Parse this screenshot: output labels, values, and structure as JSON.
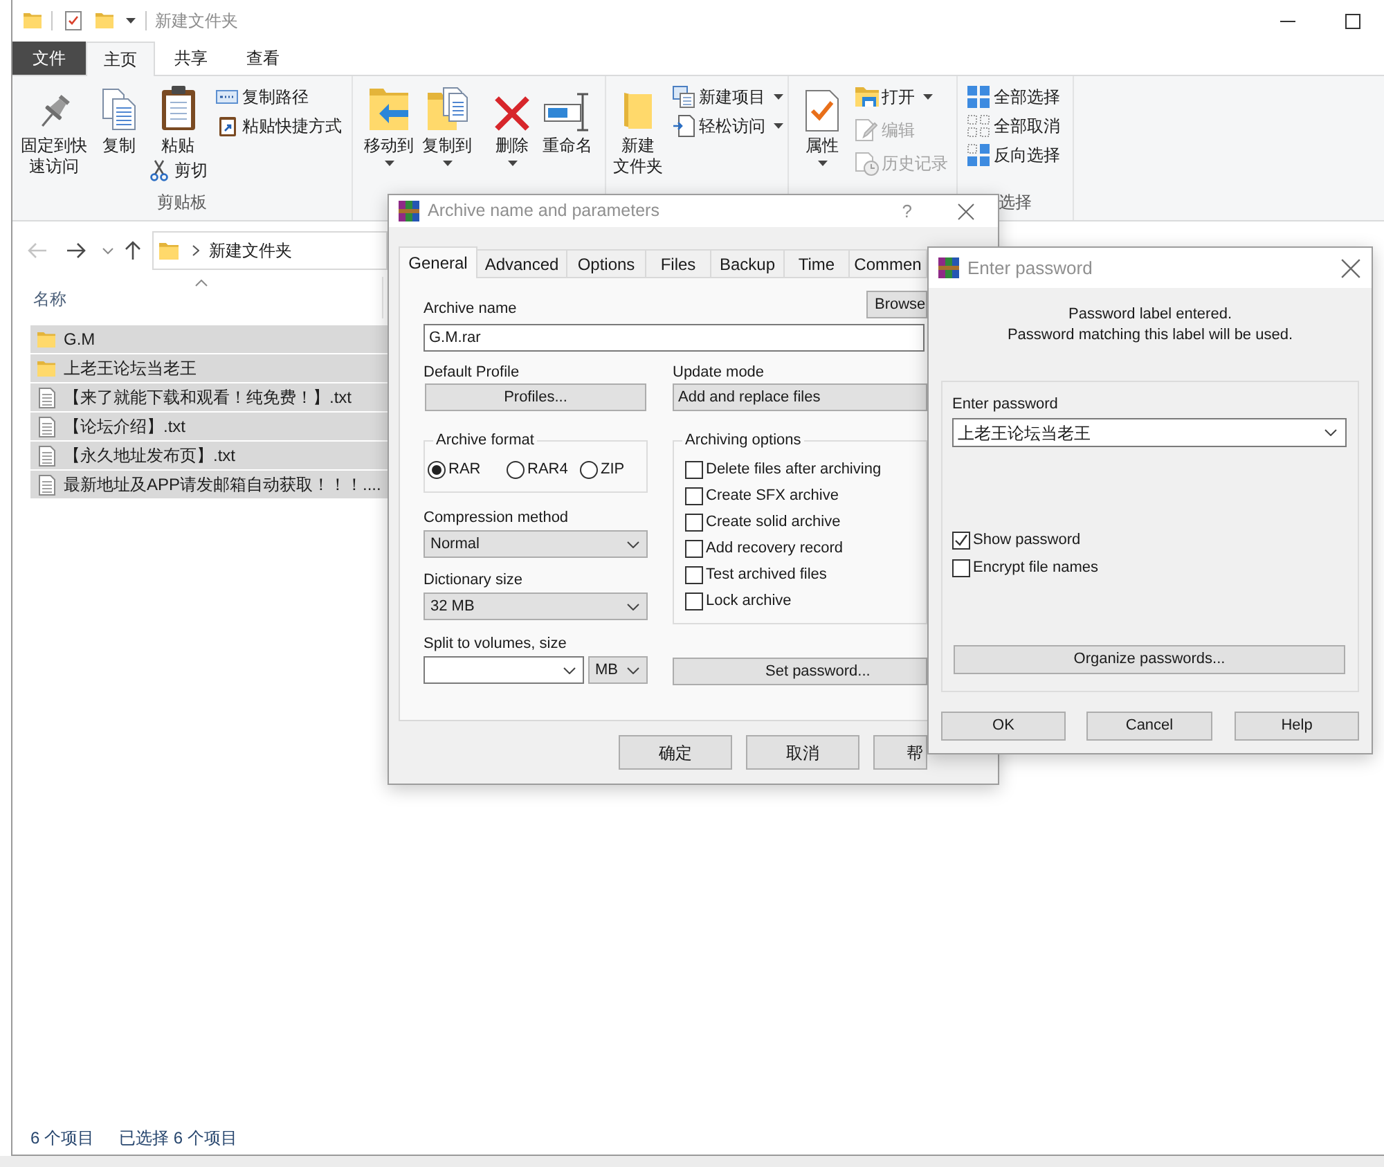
{
  "explorer": {
    "title_bar": {
      "title": "新建文件夹"
    },
    "ribbon_tabs": [
      {
        "label": "文件",
        "kind": "file",
        "selected": false
      },
      {
        "label": "主页",
        "kind": "tab",
        "selected": true
      },
      {
        "label": "共享",
        "kind": "tab",
        "selected": false
      },
      {
        "label": "查看",
        "kind": "tab",
        "selected": false
      }
    ],
    "ribbon": {
      "groups": [
        {
          "label": "剪贴板",
          "buttons": [
            {
              "lines": [
                "固定到快",
                "速访问"
              ],
              "dropdown": false,
              "disabled": false
            },
            {
              "label": "复制",
              "dropdown": false,
              "disabled": false
            },
            {
              "label": "粘贴",
              "dropdown": false,
              "disabled": false
            },
            {
              "label": "剪切",
              "dropdown": false,
              "disabled": false
            },
            {
              "label": "复制路径",
              "dropdown": false,
              "disabled": false
            },
            {
              "label": "粘贴快捷方式",
              "dropdown": false,
              "disabled": false
            }
          ]
        },
        {
          "buttons": [
            {
              "label": "移动到",
              "dropdown": true,
              "disabled": false
            },
            {
              "label": "复制到",
              "dropdown": true,
              "disabled": false
            },
            {
              "label": "删除",
              "dropdown": true,
              "disabled": false
            },
            {
              "label": "重命名",
              "dropdown": false,
              "disabled": false
            }
          ]
        },
        {
          "buttons": [
            {
              "lines": [
                "新建",
                "文件夹"
              ],
              "dropdown": false,
              "disabled": false
            },
            {
              "label": "新建项目",
              "dropdown": true,
              "disabled": false
            },
            {
              "label": "轻松访问",
              "dropdown": true,
              "disabled": false
            }
          ]
        },
        {
          "buttons": [
            {
              "label": "属性",
              "dropdown": true,
              "disabled": false
            },
            {
              "label": "打开",
              "dropdown": true,
              "disabled": false
            },
            {
              "label": "编辑",
              "dropdown": false,
              "disabled": true
            },
            {
              "label": "历史记录",
              "dropdown": false,
              "disabled": true
            }
          ]
        },
        {
          "label": "选择",
          "buttons": [
            {
              "label": "全部选择",
              "dropdown": false,
              "disabled": false
            },
            {
              "label": "全部取消",
              "dropdown": false,
              "disabled": false
            },
            {
              "label": "反向选择",
              "dropdown": false,
              "disabled": false
            }
          ]
        }
      ]
    },
    "navigation": [
      {
        "kind": "back",
        "disabled": true
      },
      {
        "kind": "forward",
        "disabled": false
      },
      {
        "kind": "recent",
        "disabled": false
      },
      {
        "kind": "up",
        "disabled": false
      }
    ],
    "address": {
      "path": "新建文件夹"
    },
    "columns": [
      {
        "label": "名称",
        "sorted": true
      }
    ],
    "files": [
      {
        "name": "G.M",
        "kind": "folder",
        "selected": true
      },
      {
        "name": "上老王论坛当老王",
        "kind": "folder",
        "selected": true
      },
      {
        "name": "【来了就能下载和观看！纯免费！】.txt",
        "kind": "text_file",
        "selected": true
      },
      {
        "name": "【论坛介绍】.txt",
        "kind": "text_file",
        "selected": true
      },
      {
        "name": "【永久地址发布页】.txt",
        "kind": "text_file",
        "selected": true
      },
      {
        "name": "最新地址及APP请发邮箱自动获取！！！....",
        "kind": "text_file",
        "selected": true
      }
    ],
    "status_bar": {
      "item_count": "6 个项目",
      "selection": "已选择 6 个项目"
    }
  },
  "archive_dialog": {
    "title": "Archive name and parameters",
    "help": "?",
    "tabs": [
      {
        "label": "General",
        "selected": true
      },
      {
        "label": "Advanced",
        "selected": false
      },
      {
        "label": "Options",
        "selected": false
      },
      {
        "label": "Files",
        "selected": false
      },
      {
        "label": "Backup",
        "selected": false
      },
      {
        "label": "Time",
        "selected": false
      },
      {
        "label": "Commen",
        "selected": false
      }
    ],
    "archive_name": {
      "label": "Archive name",
      "value": "G.M.rar",
      "browse_button": "Browse"
    },
    "default_profile": {
      "label": "Default Profile",
      "button": "Profiles..."
    },
    "update_mode": {
      "label": "Update mode",
      "value": "Add and replace files"
    },
    "archive_format": {
      "label": "Archive format",
      "options": [
        {
          "label": "RAR",
          "selected": true
        },
        {
          "label": "RAR4",
          "selected": false
        },
        {
          "label": "ZIP",
          "selected": false
        }
      ]
    },
    "archiving_options": {
      "label": "Archiving options",
      "options": [
        {
          "label": "Delete files after archiving",
          "checked": false
        },
        {
          "label": "Create SFX archive",
          "checked": false
        },
        {
          "label": "Create solid archive",
          "checked": false
        },
        {
          "label": "Add recovery record",
          "checked": false
        },
        {
          "label": "Test archived files",
          "checked": false
        },
        {
          "label": "Lock archive",
          "checked": false
        }
      ]
    },
    "compression_method": {
      "label": "Compression method",
      "value": "Normal"
    },
    "dictionary_size": {
      "label": "Dictionary size",
      "value": "32 MB"
    },
    "split_volumes": {
      "label": "Split to volumes, size",
      "unit": "MB"
    },
    "set_password_button": "Set password...",
    "buttons": [
      "确定",
      "取消",
      "帮"
    ]
  },
  "password_dialog": {
    "title": "Enter password",
    "message": [
      "Password label entered.",
      "Password matching this label will be used."
    ],
    "password": {
      "label": "Enter password",
      "value": "上老王论坛当老王"
    },
    "options": [
      {
        "label": "Show password",
        "checked": true
      },
      {
        "label": "Encrypt file names",
        "checked": false
      }
    ],
    "organize_button": "Organize passwords...",
    "buttons": [
      "OK",
      "Cancel",
      "Help"
    ]
  }
}
